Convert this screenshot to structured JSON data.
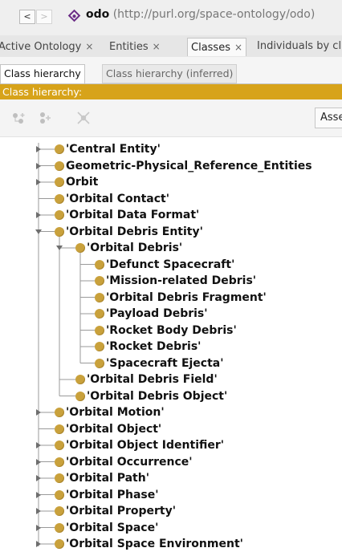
{
  "nav": {
    "back_icon": "left-arrow-icon",
    "forward_icon": "right-arrow-icon",
    "back_glyph": "<",
    "forward_glyph": ">"
  },
  "ontology": {
    "icon": "ontology-diamond-icon",
    "name": "odo",
    "url": "(http://purl.org/space-ontology/odo)"
  },
  "tabs": [
    {
      "label": "Active Ontology",
      "active": false
    },
    {
      "label": "Entities",
      "active": false
    },
    {
      "label": "Classes",
      "active": true
    },
    {
      "label": "Individuals by cl",
      "active": false
    }
  ],
  "tab_close_glyph": "×",
  "subtabs": [
    "Class hierarchy",
    "Class hierarchy (inferred)"
  ],
  "hierarchy_header": "Class hierarchy:",
  "toolbar": {
    "add_subclass_icon": "add-subclass-icon",
    "add_sibling_icon": "add-sibling-icon",
    "delete_icon": "delete-class-icon",
    "asserted_label": "Asse"
  },
  "accent_color": "#d7a31a",
  "class_dot_color": "#c9a13c",
  "tree": [
    {
      "label": "'Central Entity'",
      "depth": 0,
      "toggle": "collapsed"
    },
    {
      "label": "Geometric-Physical_Reference_Entities",
      "depth": 0,
      "toggle": "collapsed"
    },
    {
      "label": "Orbit",
      "depth": 0,
      "toggle": "collapsed"
    },
    {
      "label": "'Orbital Contact'",
      "depth": 0,
      "toggle": "none"
    },
    {
      "label": "'Orbital Data Format'",
      "depth": 0,
      "toggle": "collapsed"
    },
    {
      "label": "'Orbital Debris Entity'",
      "depth": 0,
      "toggle": "expanded"
    },
    {
      "label": "'Orbital Debris'",
      "depth": 1,
      "toggle": "expanded"
    },
    {
      "label": "'Defunct Spacecraft'",
      "depth": 2,
      "toggle": "none"
    },
    {
      "label": "'Mission-related Debris'",
      "depth": 2,
      "toggle": "none"
    },
    {
      "label": "'Orbital Debris Fragment'",
      "depth": 2,
      "toggle": "none"
    },
    {
      "label": "'Payload Debris'",
      "depth": 2,
      "toggle": "none"
    },
    {
      "label": "'Rocket Body Debris'",
      "depth": 2,
      "toggle": "none"
    },
    {
      "label": "'Rocket Debris'",
      "depth": 2,
      "toggle": "none"
    },
    {
      "label": "'Spacecraft Ejecta'",
      "depth": 2,
      "toggle": "none"
    },
    {
      "label": "'Orbital Debris Field'",
      "depth": 1,
      "toggle": "none"
    },
    {
      "label": "'Orbital Debris Object'",
      "depth": 1,
      "toggle": "none"
    },
    {
      "label": "'Orbital Motion'",
      "depth": 0,
      "toggle": "collapsed"
    },
    {
      "label": "'Orbital Object'",
      "depth": 0,
      "toggle": "none"
    },
    {
      "label": "'Orbital Object Identifier'",
      "depth": 0,
      "toggle": "collapsed"
    },
    {
      "label": "'Orbital Occurrence'",
      "depth": 0,
      "toggle": "collapsed"
    },
    {
      "label": "'Orbital Path'",
      "depth": 0,
      "toggle": "collapsed"
    },
    {
      "label": "'Orbital Phase'",
      "depth": 0,
      "toggle": "collapsed"
    },
    {
      "label": "'Orbital Property'",
      "depth": 0,
      "toggle": "collapsed"
    },
    {
      "label": "'Orbital Space'",
      "depth": 0,
      "toggle": "collapsed"
    },
    {
      "label": "'Orbital Space Environment'",
      "depth": 0,
      "toggle": "collapsed"
    }
  ]
}
